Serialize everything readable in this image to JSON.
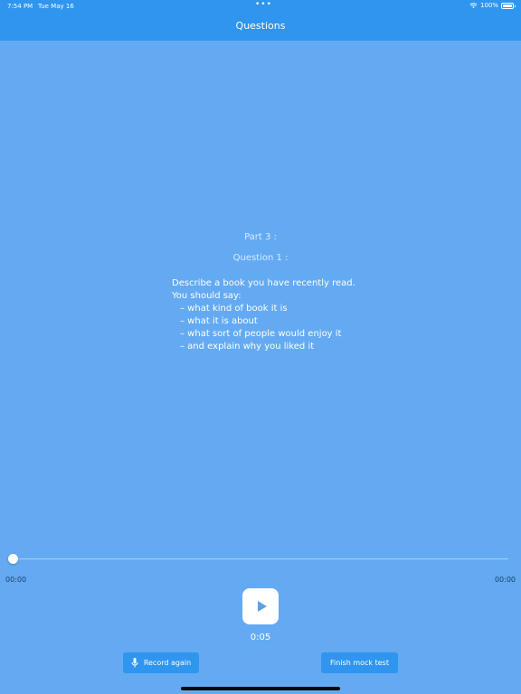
{
  "status_bar": {
    "time": "7:54 PM",
    "date": "Tue May 16",
    "dots": "•••",
    "battery_percent": "100%",
    "wifi_icon": "wifi-icon",
    "battery_icon": "battery-icon"
  },
  "nav": {
    "title": "Questions"
  },
  "question": {
    "part": "Part 3 :",
    "number": "Question 1 :",
    "lines": [
      "Describe a book you have recently read.",
      "You should say:",
      "– what kind of book it is",
      "– what it is about",
      "– what sort of people would enjoy it",
      "– and explain why you liked it"
    ]
  },
  "player": {
    "position": "00:00",
    "duration": "00:00",
    "progress": 0,
    "elapsed": "0:05",
    "play_icon": "play-icon"
  },
  "actions": {
    "record_again": "Record again",
    "finish": "Finish mock test",
    "mic_icon": "mic-icon"
  },
  "colors": {
    "background": "#63aaf2",
    "bar": "#2f95ef",
    "button": "#2f95ef"
  }
}
